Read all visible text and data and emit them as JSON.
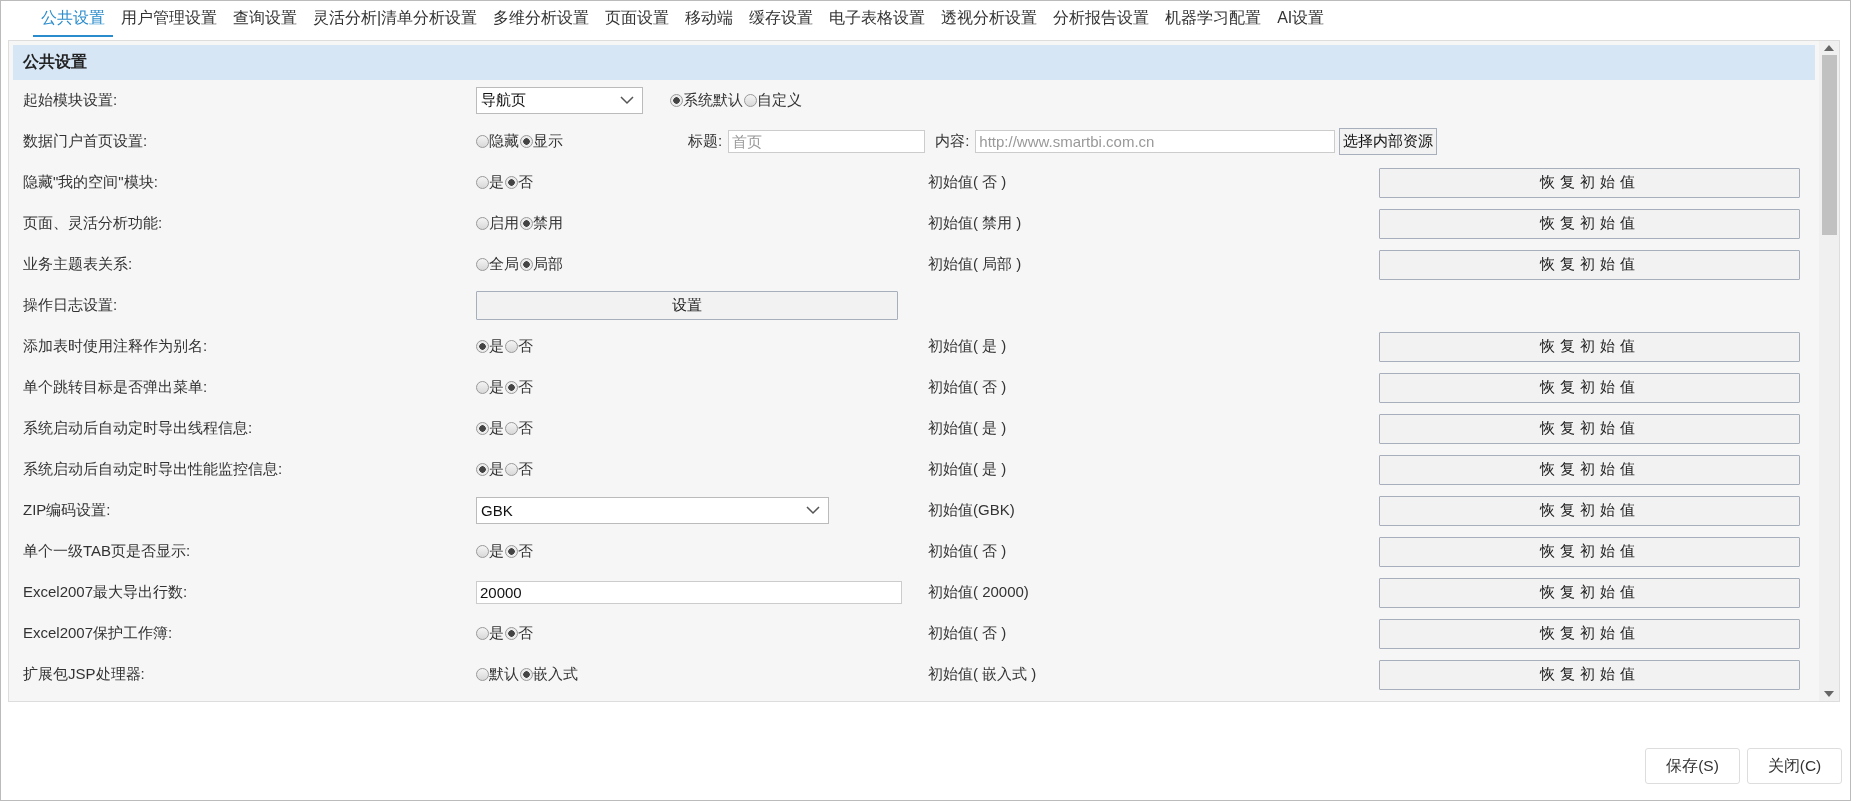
{
  "tabs": [
    {
      "label": "公共设置",
      "selected": true
    },
    {
      "label": "用户管理设置",
      "selected": false
    },
    {
      "label": "查询设置",
      "selected": false
    },
    {
      "label": "灵活分析|清单分析设置",
      "selected": false
    },
    {
      "label": "多维分析设置",
      "selected": false
    },
    {
      "label": "页面设置",
      "selected": false
    },
    {
      "label": "移动端",
      "selected": false
    },
    {
      "label": "缓存设置",
      "selected": false
    },
    {
      "label": "电子表格设置",
      "selected": false
    },
    {
      "label": "透视分析设置",
      "selected": false
    },
    {
      "label": "分析报告设置",
      "selected": false
    },
    {
      "label": "机器学习配置",
      "selected": false
    },
    {
      "label": "AI设置",
      "selected": false
    }
  ],
  "section": {
    "title": "公共设置"
  },
  "settings": [
    {
      "kind": "select-radio",
      "label": "起始模块设置:",
      "value": "导航页",
      "options": [
        {
          "label": "系统默认",
          "selected": true
        },
        {
          "label": "自定义",
          "selected": false
        }
      ]
    },
    {
      "kind": "portal",
      "label": "数据门户首页设置:",
      "options": [
        {
          "label": "隐藏",
          "selected": false
        },
        {
          "label": "显示",
          "selected": true
        }
      ],
      "title_label": "标题:",
      "title_placeholder": "首页",
      "content_label": "内容:",
      "content_placeholder": "http://www.smartbi.com.cn",
      "button": "选择内部资源"
    },
    {
      "kind": "radio",
      "label": "隐藏\"我的空间\"模块:",
      "options": [
        {
          "label": "是",
          "selected": false
        },
        {
          "label": "否",
          "selected": true
        }
      ],
      "initial": "初始值( 否 )",
      "reset": "恢复初始值"
    },
    {
      "kind": "radio",
      "label": "页面、灵活分析功能:",
      "options": [
        {
          "label": "启用",
          "selected": false
        },
        {
          "label": "禁用",
          "selected": true
        }
      ],
      "initial": "初始值( 禁用 )",
      "reset": "恢复初始值"
    },
    {
      "kind": "radio",
      "label": "业务主题表关系:",
      "options": [
        {
          "label": "全局",
          "selected": false
        },
        {
          "label": "局部",
          "selected": true
        }
      ],
      "initial": "初始值( 局部 )",
      "reset": "恢复初始值"
    },
    {
      "kind": "button",
      "label": "操作日志设置:",
      "button": "设置"
    },
    {
      "kind": "radio",
      "label": "添加表时使用注释作为别名:",
      "options": [
        {
          "label": "是",
          "selected": true
        },
        {
          "label": "否",
          "selected": false
        }
      ],
      "initial": "初始值( 是 )",
      "reset": "恢复初始值"
    },
    {
      "kind": "radio",
      "label": "单个跳转目标是否弹出菜单:",
      "options": [
        {
          "label": "是",
          "selected": false
        },
        {
          "label": "否",
          "selected": true
        }
      ],
      "initial": "初始值( 否 )",
      "reset": "恢复初始值"
    },
    {
      "kind": "radio",
      "label": "系统启动后自动定时导出线程信息:",
      "options": [
        {
          "label": "是",
          "selected": true
        },
        {
          "label": "否",
          "selected": false
        }
      ],
      "initial": "初始值( 是 )",
      "reset": "恢复初始值"
    },
    {
      "kind": "radio",
      "label": "系统启动后自动定时导出性能监控信息:",
      "options": [
        {
          "label": "是",
          "selected": true
        },
        {
          "label": "否",
          "selected": false
        }
      ],
      "initial": "初始值( 是 )",
      "reset": "恢复初始值"
    },
    {
      "kind": "select",
      "label": "ZIP编码设置:",
      "value": "GBK",
      "initial": "初始值(GBK)",
      "reset": "恢复初始值"
    },
    {
      "kind": "radio",
      "label": "单个一级TAB页是否显示:",
      "options": [
        {
          "label": "是",
          "selected": false
        },
        {
          "label": "否",
          "selected": true
        }
      ],
      "initial": "初始值( 否 )",
      "reset": "恢复初始值"
    },
    {
      "kind": "text",
      "label": "Excel2007最大导出行数:",
      "value": "20000",
      "initial": "初始值( 20000)",
      "reset": "恢复初始值"
    },
    {
      "kind": "radio",
      "label": "Excel2007保护工作簿:",
      "options": [
        {
          "label": "是",
          "selected": false
        },
        {
          "label": "否",
          "selected": true
        }
      ],
      "initial": "初始值( 否 )",
      "reset": "恢复初始值"
    },
    {
      "kind": "radio",
      "label": "扩展包JSP处理器:",
      "options": [
        {
          "label": "默认",
          "selected": false
        },
        {
          "label": "嵌入式",
          "selected": true
        }
      ],
      "initial": "初始值( 嵌入式 )",
      "reset": "恢复初始值"
    }
  ],
  "footer": {
    "buttons": [
      "保存(S)",
      "关闭(C)"
    ]
  }
}
